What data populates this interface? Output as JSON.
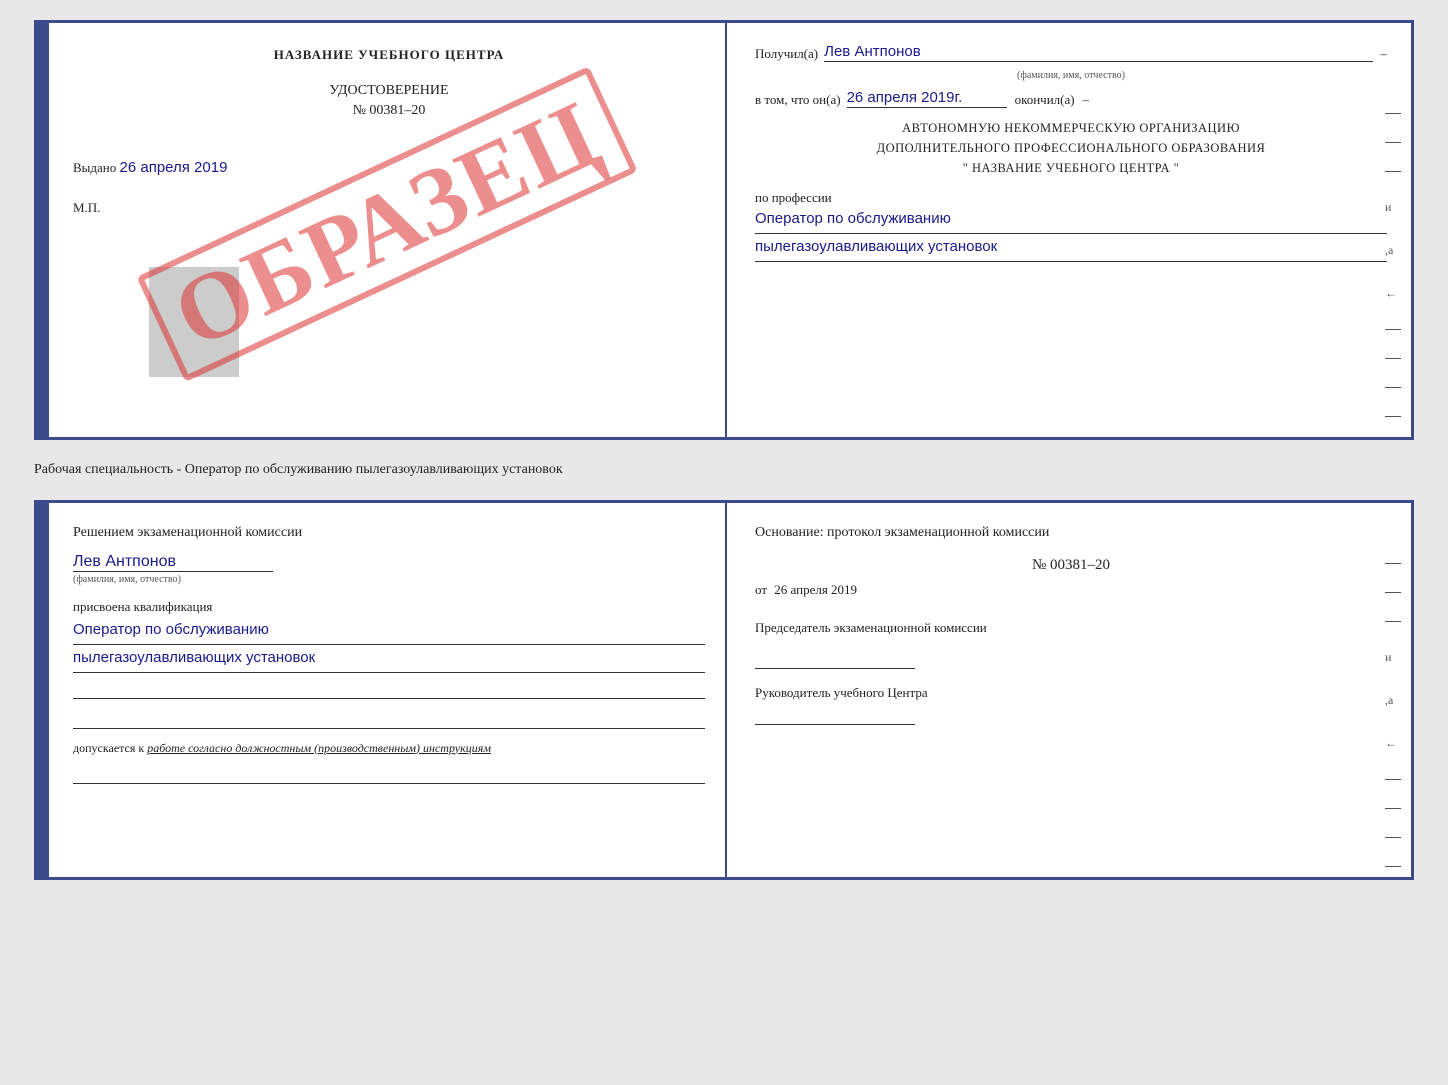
{
  "top_cert": {
    "left": {
      "title": "НАЗВАНИЕ УЧЕБНОГО ЦЕНТРА",
      "watermark": "ОБРАЗЕЦ",
      "udostoverenie_label": "УДОСТОВЕРЕНИЕ",
      "number": "№ 00381–20",
      "vydano_label": "Выдано",
      "vydano_date": "26 апреля 2019",
      "mp_label": "М.П."
    },
    "right": {
      "poluchil_label": "Получил(а)",
      "poluchil_name": "Лев Антпонов",
      "fio_subtext": "(фамилия, имя, отчество)",
      "vtom_label": "в том, что он(а)",
      "vtom_date": "26 апреля 2019г.",
      "okonchil_label": "окончил(а)",
      "org_line1": "АВТОНОМНУЮ НЕКОММЕРЧЕСКУЮ ОРГАНИЗАЦИЮ",
      "org_line2": "ДОПОЛНИТЕЛЬНОГО ПРОФЕССИОНАЛЬНОГО ОБРАЗОВАНИЯ",
      "org_line3": "\"  НАЗВАНИЕ УЧЕБНОГО ЦЕНТРА  \"",
      "profession_label": "по профессии",
      "profession_line1": "Оператор по обслуживанию",
      "profession_line2": "пылегазоулавливающих установок"
    }
  },
  "separator": {
    "text": "Рабочая специальность - Оператор по обслуживанию пылегазоулавливающих установок"
  },
  "bottom_cert": {
    "left": {
      "resheniem_label": "Решением экзаменационной комиссии",
      "name": "Лев Антпонов",
      "fio_subtext": "(фамилия, имя, отчество)",
      "prisvoena_label": "присвоена квалификация",
      "profession_line1": "Оператор по обслуживанию",
      "profession_line2": "пылегазоулавливающих установок",
      "dopuskaetsya_label": "допускается к",
      "dopuskaetsya_value": "работе согласно должностным (производственным) инструкциям"
    },
    "right": {
      "osnovanie_label": "Основание: протокол экзаменационной комиссии",
      "protocol_number": "№  00381–20",
      "ot_label": "от",
      "ot_date": "26 апреля 2019",
      "predsedatel_label": "Председатель экзаменационной комиссии",
      "rukovoditel_label": "Руководитель учебного Центра"
    }
  }
}
